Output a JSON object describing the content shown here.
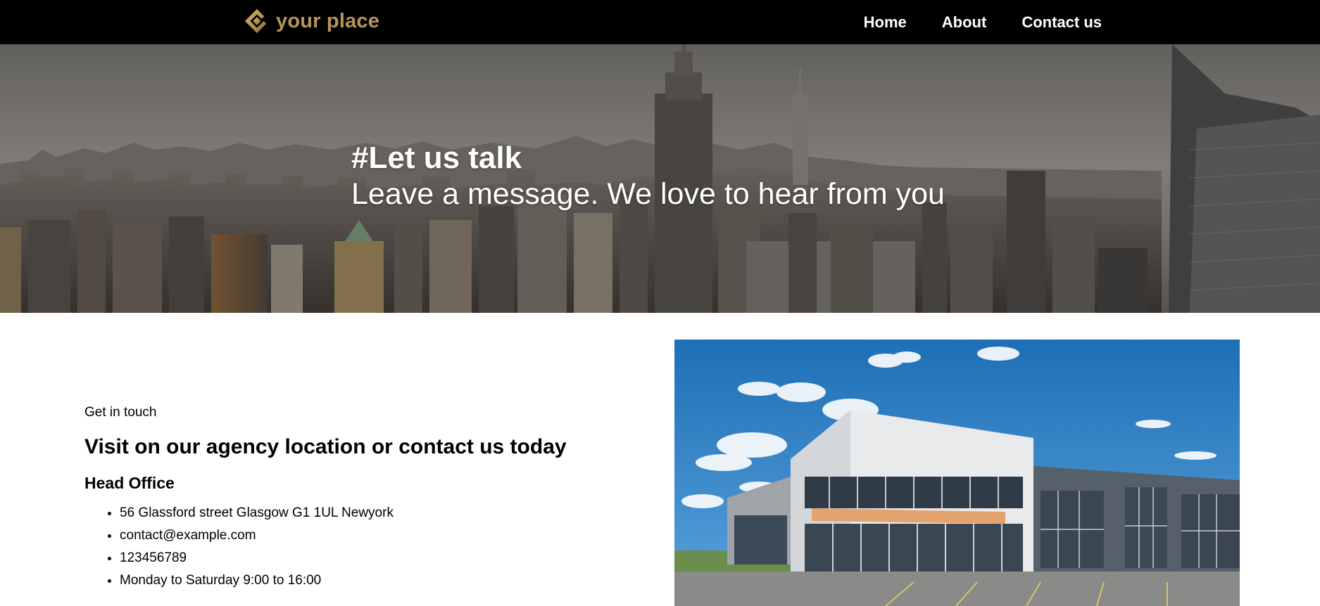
{
  "brand": {
    "name": "your place",
    "icon": "diamond-logo-icon",
    "color": "#b8945a"
  },
  "nav": {
    "items": [
      {
        "label": "Home"
      },
      {
        "label": "About"
      },
      {
        "label": "Contact us"
      }
    ]
  },
  "hero": {
    "title": "#Let us talk",
    "subtitle": "Leave a message. We love to hear from you"
  },
  "contact": {
    "eyebrow": "Get in touch",
    "heading": "Visit on our agency location or contact us today",
    "office_heading": "Head Office",
    "details": [
      "56 Glassford street Glasgow G1 1UL Newyork",
      "contact@example.com",
      "123456789",
      "Monday to Saturday 9:00 to 16:00"
    ]
  },
  "colors": {
    "navbar_bg": "#000000",
    "nav_text": "#ffffff",
    "body_text": "#000000"
  }
}
